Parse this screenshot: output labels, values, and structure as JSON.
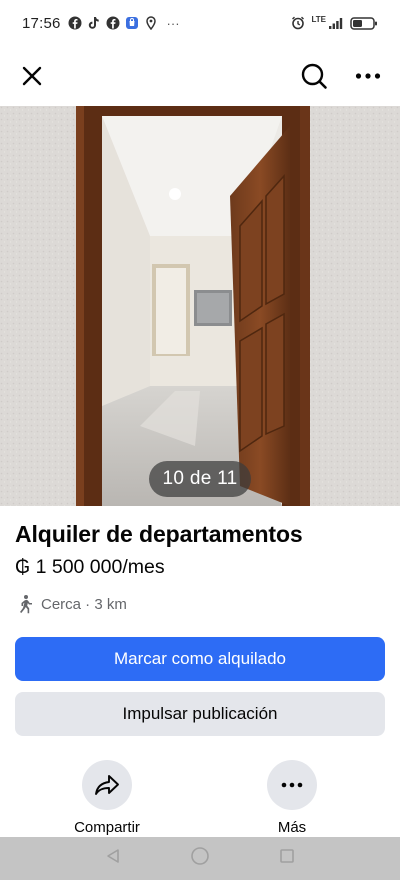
{
  "status_bar": {
    "time": "17:56",
    "more": "···",
    "network": "LTE",
    "icons": [
      "facebook-icon",
      "tiktok-icon",
      "facebook-icon",
      "shopping-bag-icon",
      "location-pin-icon",
      "alarm-icon",
      "signal-icon",
      "battery-icon"
    ]
  },
  "nav": {
    "close_icon": "close-icon",
    "search_icon": "search-icon",
    "more_icon": "more-horizontal-icon"
  },
  "photo": {
    "counter": "10 de 11"
  },
  "listing": {
    "title": "Alquiler de departamentos",
    "price": "₲ 1 500 000/mes",
    "distance": "Cerca · 3 km"
  },
  "buttons": {
    "primary": "Marcar como alquilado",
    "secondary": "Impulsar publicación"
  },
  "actions": [
    {
      "label": "Compartir",
      "icon": "share-icon"
    },
    {
      "label": "Más",
      "icon": "more-horizontal-icon"
    }
  ],
  "colors": {
    "primary": "#2d6cf5",
    "secondary_bg": "#e4e6eb",
    "muted_text": "#65676b"
  }
}
